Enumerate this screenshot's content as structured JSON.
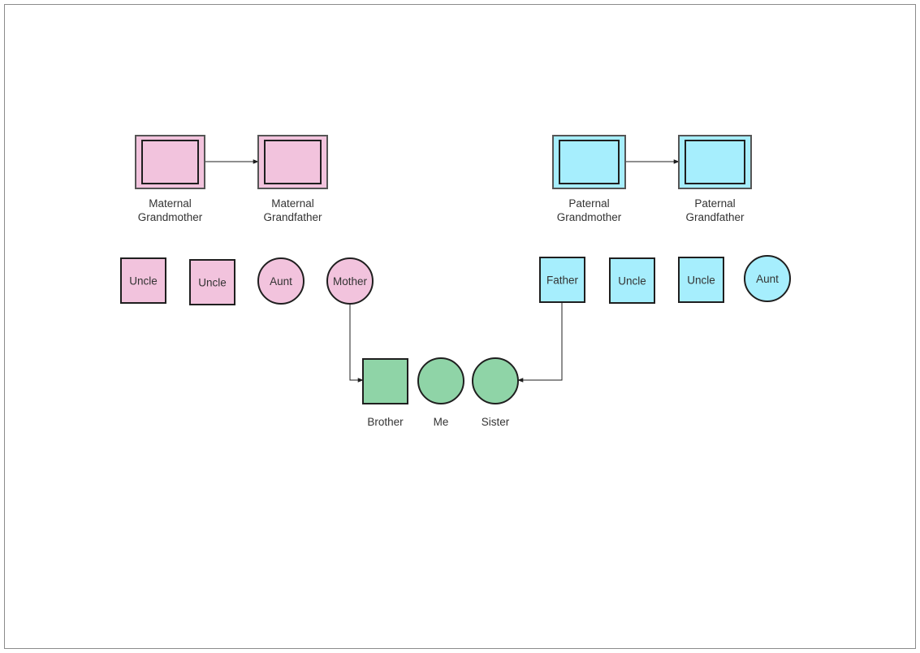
{
  "colors": {
    "maternal": "#f2c3dd",
    "paternal": "#a6eefd",
    "siblings": "#8fd4a7",
    "stroke": "#1f1f1f",
    "text": "#333333",
    "page_border": "#8c8c8c"
  },
  "nodes": [
    {
      "id": "mgm",
      "shape": "double-rect",
      "family": "maternal",
      "label_lines": [
        "Maternal",
        "Grandmother"
      ],
      "label_position": "below"
    },
    {
      "id": "mgf",
      "shape": "double-rect",
      "family": "maternal",
      "label_lines": [
        "Maternal",
        "Grandfather"
      ],
      "label_position": "below"
    },
    {
      "id": "pgm",
      "shape": "double-rect",
      "family": "paternal",
      "label_lines": [
        "Paternal",
        "Grandmother"
      ],
      "label_position": "below"
    },
    {
      "id": "pgf",
      "shape": "double-rect",
      "family": "paternal",
      "label_lines": [
        "Paternal",
        "Grandfather"
      ],
      "label_position": "below"
    },
    {
      "id": "m_uncle1",
      "shape": "square",
      "family": "maternal",
      "label_lines": [
        "Uncle"
      ],
      "label_position": "inside"
    },
    {
      "id": "m_uncle2",
      "shape": "square",
      "family": "maternal",
      "label_lines": [
        "Uncle"
      ],
      "label_position": "inside"
    },
    {
      "id": "m_aunt",
      "shape": "circle",
      "family": "maternal",
      "label_lines": [
        "Aunt"
      ],
      "label_position": "inside"
    },
    {
      "id": "mother",
      "shape": "circle",
      "family": "maternal",
      "label_lines": [
        "Mother"
      ],
      "label_position": "inside"
    },
    {
      "id": "father",
      "shape": "square",
      "family": "paternal",
      "label_lines": [
        "Father"
      ],
      "label_position": "inside"
    },
    {
      "id": "p_uncle1",
      "shape": "square",
      "family": "paternal",
      "label_lines": [
        "Uncle"
      ],
      "label_position": "inside"
    },
    {
      "id": "p_uncle2",
      "shape": "square",
      "family": "paternal",
      "label_lines": [
        "Uncle"
      ],
      "label_position": "inside"
    },
    {
      "id": "p_aunt",
      "shape": "circle",
      "family": "paternal",
      "label_lines": [
        "Aunt"
      ],
      "label_position": "inside"
    },
    {
      "id": "brother",
      "shape": "square",
      "family": "siblings",
      "label_lines": [
        "Brother"
      ],
      "label_position": "below"
    },
    {
      "id": "me",
      "shape": "circle",
      "family": "siblings",
      "label_lines": [
        "Me"
      ],
      "label_position": "below"
    },
    {
      "id": "sister",
      "shape": "circle",
      "family": "siblings",
      "label_lines": [
        "Sister"
      ],
      "label_position": "below"
    }
  ],
  "edges": [
    {
      "from": "mgm",
      "to": "mgf"
    },
    {
      "from": "pgm",
      "to": "pgf"
    },
    {
      "from": "mother",
      "to": "brother"
    },
    {
      "from": "father",
      "to": "sister"
    }
  ]
}
